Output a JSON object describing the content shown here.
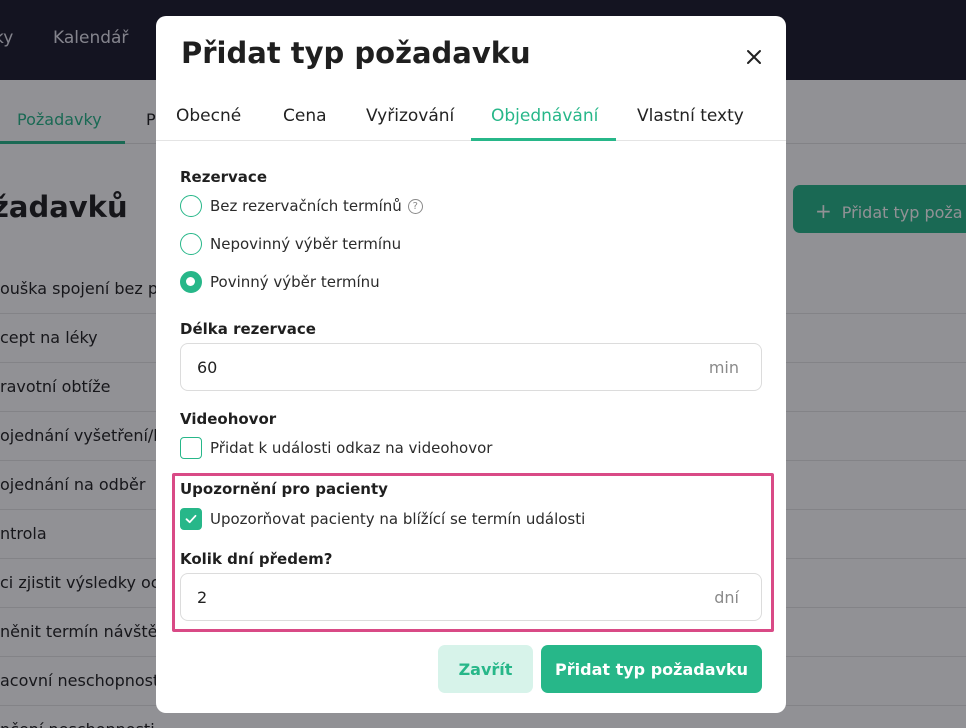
{
  "background": {
    "topnav": [
      "ky",
      "Kalendář"
    ],
    "subnav": [
      "Požadavky",
      "P"
    ],
    "page_title": "žadavků",
    "add_button_label": "Přidat typ poža",
    "list_items": [
      "ouška spojení bez po",
      "cept na léky",
      "ravotní obtíže",
      "ojednání vyšetření/k",
      "ojednání na odběr",
      "ntrola",
      "ci zjistit výsledky oc",
      "něnit termín návštěv",
      "acovní neschopnost",
      "nčení neschopnosti"
    ]
  },
  "modal": {
    "title": "Přidat typ požadavku",
    "tabs": [
      "Obecné",
      "Cena",
      "Vyřizování",
      "Objednávání",
      "Vlastní texty"
    ],
    "active_tab": "Objednávání",
    "reservation": {
      "label": "Rezervace",
      "options": [
        "Bez rezervačních termínů",
        "Nepovinný výběr termínu",
        "Povinný výběr termínu"
      ],
      "selected": "Povinný výběr termínu"
    },
    "duration": {
      "label": "Délka rezervace",
      "value": "60",
      "unit": "min"
    },
    "video": {
      "label": "Videohovor",
      "checkbox_label": "Přidat k události odkaz na videohovor",
      "checked": false
    },
    "notify": {
      "label": "Upozornění pro pacienty",
      "checkbox_label": "Upozorňovat pacienty na blížící se termín události",
      "checked": true
    },
    "days_before": {
      "label": "Kolik dní předem?",
      "value": "2",
      "unit": "dní"
    },
    "buttons": {
      "close": "Zavřít",
      "submit": "Přidat typ požadavku"
    }
  },
  "colors": {
    "accent": "#27b789",
    "accent_light": "#d7f3ea",
    "highlight": "#d94a86",
    "topbar": "#1d1c2c"
  }
}
